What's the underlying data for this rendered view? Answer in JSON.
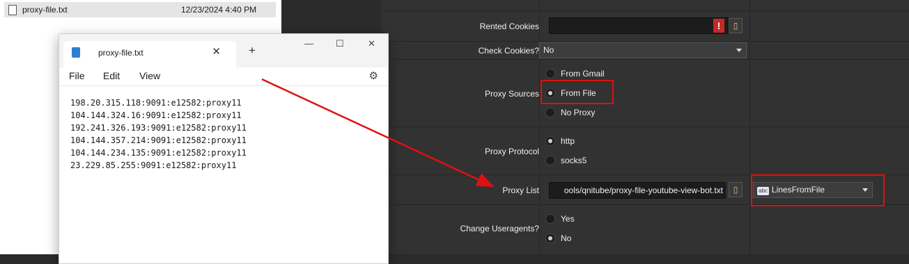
{
  "explorer": {
    "file_name": "proxy-file.txt",
    "file_date": "12/23/2024 4:40 PM"
  },
  "notepad": {
    "tab_title": "proxy-file.txt",
    "close_glyph": "✕",
    "plus_glyph": "+",
    "minimize_glyph": "—",
    "maximize_glyph": "☐",
    "window_close_glyph": "✕",
    "gear_glyph": "⚙",
    "menu": [
      "File",
      "Edit",
      "View"
    ],
    "lines": [
      "198.20.315.118:9091:e12582:proxy11",
      "104.144.324.16:9091:e12582:proxy11",
      "192.241.326.193:9091:e12582:proxy11",
      "104.144.357.214:9091:e12582:proxy11",
      "104.144.234.135:9091:e12582:proxy11",
      "23.229.85.255:9091:e12582:proxy11"
    ]
  },
  "settings": {
    "rented_cookies": {
      "label": "Rented Cookies",
      "bang": "!",
      "folder_glyph": "▯"
    },
    "check_cookies": {
      "label": "Check Cookies?",
      "value": "No"
    },
    "proxy_sources": {
      "label": "Proxy Sources",
      "options": [
        "From Gmail",
        "From File",
        "No Proxy"
      ],
      "selected": "From File"
    },
    "proxy_protocol": {
      "label": "Proxy Protocol",
      "options": [
        "http",
        "socks5"
      ],
      "selected": "http"
    },
    "proxy_list": {
      "label": "Proxy List",
      "path": "ools/qnitube/proxy-file-youtube-view-bot.txt",
      "folder_glyph": "▯",
      "mode_badge": "abc",
      "mode_value": "LinesFromFile"
    },
    "change_useragents": {
      "label": "Change Useragents?",
      "options": [
        "Yes",
        "No"
      ],
      "selected": "No"
    }
  },
  "annotation_color": "#e01010"
}
